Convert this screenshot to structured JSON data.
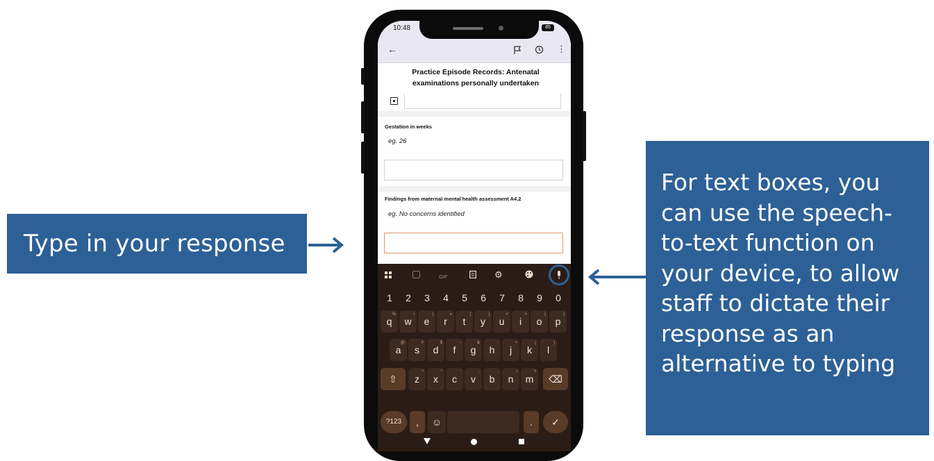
{
  "callouts": {
    "left_text": "Type in your response",
    "right_lines": [
      "For text boxes, you",
      "can use the speech-",
      "to-text function on",
      "your device, to allow",
      "staff to dictate their",
      "response as an",
      "alternative to typing"
    ],
    "box_color": "#2d6096"
  },
  "phone": {
    "status": {
      "time": "10:48",
      "battery": "85"
    },
    "appbar": {
      "back_icon": "arrow-left-icon",
      "icons": [
        "flag-icon",
        "history-icon",
        "more-vert-icon"
      ]
    },
    "title": "Practice Episode Records: Antenatal examinations personally undertaken",
    "fields": [
      {
        "label": "Gestation in weeks",
        "placeholder": "eg. 26",
        "value": ""
      },
      {
        "label": "Findings from maternal mental health assessment A4.2",
        "placeholder": "eg. No concerns identified",
        "value": ""
      }
    ],
    "keyboard": {
      "toolbar": [
        "apps-icon",
        "sticker-icon",
        "GIF",
        "clipboard-icon",
        "settings-icon",
        "palette-icon",
        "mic-icon"
      ],
      "numbers": [
        "1",
        "2",
        "3",
        "4",
        "5",
        "6",
        "7",
        "8",
        "9",
        "0"
      ],
      "row1": [
        "q",
        "w",
        "e",
        "r",
        "t",
        "y",
        "u",
        "i",
        "o",
        "p"
      ],
      "row1_alt": [
        "%",
        "\\",
        "|",
        "=",
        "[",
        "]",
        "<",
        ">",
        "{",
        "}"
      ],
      "row2": [
        "a",
        "s",
        "d",
        "f",
        "g",
        "h",
        "j",
        "k",
        "l"
      ],
      "row2_alt": [
        "@",
        "#",
        "$",
        "-",
        "&",
        "-",
        "+",
        "(",
        ")"
      ],
      "row3": [
        "z",
        "x",
        "c",
        "v",
        "b",
        "n",
        "m"
      ],
      "row3_alt": [
        "*",
        "\"",
        "'",
        ":",
        ";",
        "!",
        "?"
      ],
      "bottom": {
        "symbols": "?123",
        "comma": ",",
        "period": "."
      },
      "accent": "#2d6096"
    }
  }
}
